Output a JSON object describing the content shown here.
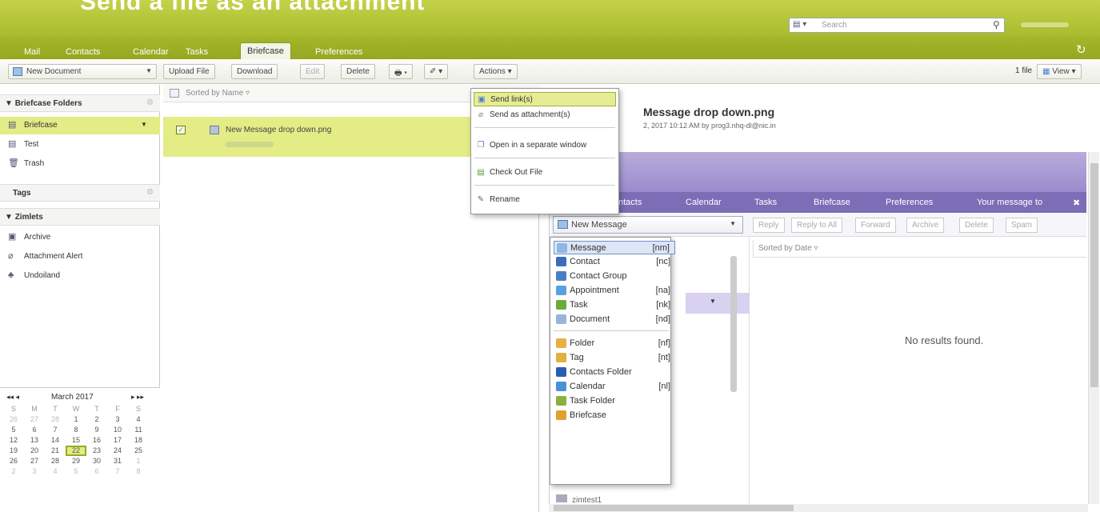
{
  "header": {
    "partial_title": "Send a file as an attachment",
    "search_scope": "▾",
    "search_placeholder": "Search"
  },
  "app_tabs": [
    "Mail",
    "Contacts",
    "Calendar",
    "Tasks",
    "Briefcase",
    "Preferences"
  ],
  "toolbar": {
    "new_document": "New Document",
    "upload_file": "Upload File",
    "download": "Download",
    "edit": "Edit",
    "delete": "Delete",
    "actions": "Actions",
    "file_count": "1 file",
    "view": "View"
  },
  "sidebar": {
    "briefcase_folders_head": "Briefcase Folders",
    "folders": [
      "Briefcase",
      "Test",
      "Trash"
    ],
    "tags_head": "Tags",
    "zimlets_head": "Zimlets",
    "zimlets": [
      "Archive",
      "Attachment Alert",
      "Undoiland"
    ]
  },
  "calendar": {
    "title": "March 2017",
    "prev": "◂◂  ◂",
    "next": "▸  ▸▸",
    "days_head": [
      "S",
      "M",
      "T",
      "W",
      "T",
      "F",
      "S"
    ],
    "weeks": [
      [
        "26",
        "27",
        "28",
        "1",
        "2",
        "3",
        "4"
      ],
      [
        "5",
        "6",
        "7",
        "8",
        "9",
        "10",
        "11"
      ],
      [
        "12",
        "13",
        "14",
        "15",
        "16",
        "17",
        "18"
      ],
      [
        "19",
        "20",
        "21",
        "22",
        "23",
        "24",
        "25"
      ],
      [
        "26",
        "27",
        "28",
        "29",
        "30",
        "31",
        "1"
      ],
      [
        "2",
        "3",
        "4",
        "5",
        "6",
        "7",
        "8"
      ]
    ],
    "today": "22"
  },
  "list": {
    "sort_label": "Sorted by Name",
    "file_name": "New Message drop down.png"
  },
  "preview": {
    "title": "Message drop down.png",
    "meta": "2, 2017 10:12 AM by prog3.nhq-dl@nic.in"
  },
  "actions_menu": {
    "items": [
      "Send link(s)",
      "Send as attachment(s)",
      "Open in a separate window",
      "Check Out File",
      "Rename"
    ]
  },
  "embedded": {
    "tabs": [
      "ntacts",
      "Calendar",
      "Tasks",
      "Briefcase",
      "Preferences",
      "Your message to"
    ],
    "close": "✖",
    "new_message": "New Message",
    "buttons": [
      "Reply",
      "Reply to All",
      "Forward",
      "Archive",
      "Delete",
      "Spam"
    ],
    "sort_label": "Sorted by Date",
    "no_results": "No results found.",
    "folder_label": "zimtest1"
  },
  "new_message_menu": {
    "items": [
      {
        "label": "Message",
        "key": "[nm]",
        "color": "#8fb6e4"
      },
      {
        "label": "Contact",
        "key": "[nc]",
        "color": "#3a6fb6"
      },
      {
        "label": "Contact Group",
        "key": "",
        "color": "#4a7fc6"
      },
      {
        "label": "Appointment",
        "key": "[na]",
        "color": "#5aa0e0"
      },
      {
        "label": "Task",
        "key": "[nk]",
        "color": "#6aaa3a"
      },
      {
        "label": "Document",
        "key": "[nd]",
        "color": "#9ab4d8"
      },
      {
        "label": "Folder",
        "key": "[nf]",
        "color": "#e8b040"
      },
      {
        "label": "Tag",
        "key": "[nt]",
        "color": "#e0b040"
      },
      {
        "label": "Contacts Folder",
        "key": "",
        "color": "#2a5fae"
      },
      {
        "label": "Calendar",
        "key": "[nl]",
        "color": "#4a90d8"
      },
      {
        "label": "Task Folder",
        "key": "",
        "color": "#8ab040"
      },
      {
        "label": "Briefcase",
        "key": "",
        "color": "#e0a030"
      }
    ]
  }
}
